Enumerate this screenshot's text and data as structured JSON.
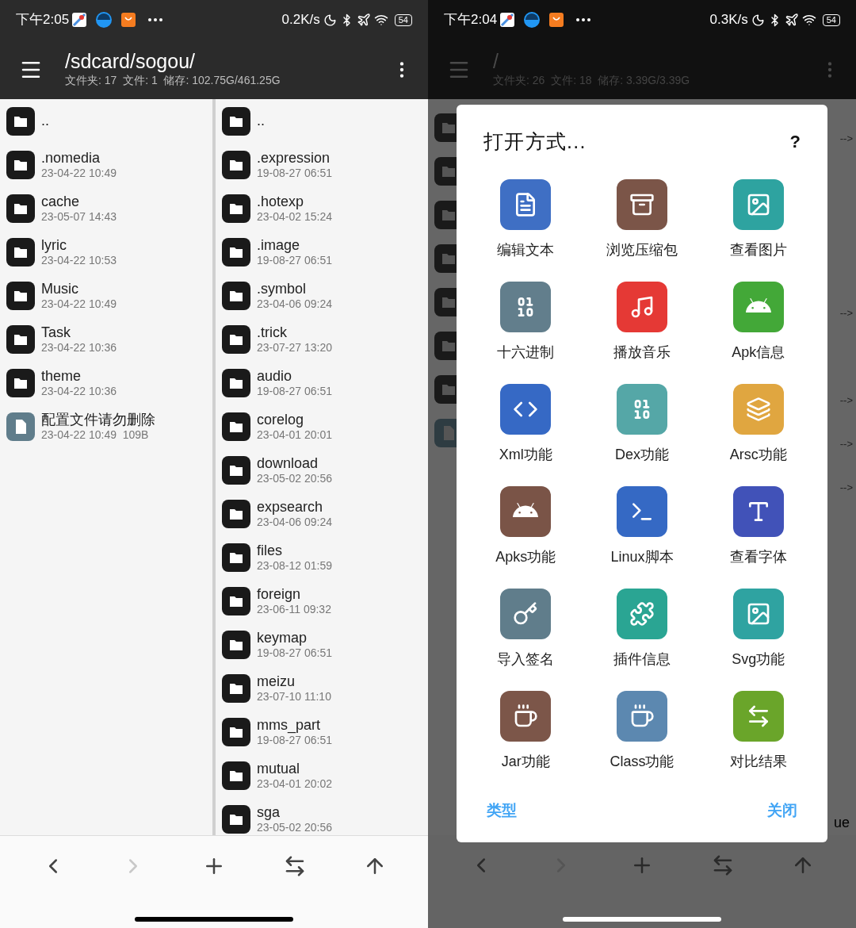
{
  "left_phone": {
    "status_bar": {
      "time": "下午2:05",
      "speed": "0.2K/s",
      "battery": "54"
    },
    "toolbar": {
      "path": "/sdcard/sogou/",
      "info": "文件夹: 17  文件: 1  储存: 102.75G/461.25G"
    },
    "panes": [
      {
        "rows": [
          {
            "kind": "folder",
            "name": ".."
          },
          {
            "kind": "folder",
            "name": ".nomedia",
            "meta": "23-04-22 10:49"
          },
          {
            "kind": "folder",
            "name": "cache",
            "meta": "23-05-07 14:43"
          },
          {
            "kind": "folder",
            "name": "lyric",
            "meta": "23-04-22 10:53"
          },
          {
            "kind": "folder",
            "name": "Music",
            "meta": "23-04-22 10:49"
          },
          {
            "kind": "folder",
            "name": "Task",
            "meta": "23-04-22 10:36"
          },
          {
            "kind": "folder",
            "name": "theme",
            "meta": "23-04-22 10:36"
          },
          {
            "kind": "file",
            "name": "配置文件请勿删除",
            "meta": "23-04-22 10:49  109B"
          }
        ]
      },
      {
        "rows": [
          {
            "kind": "folder",
            "name": ".."
          },
          {
            "kind": "folder",
            "name": ".expression",
            "meta": "19-08-27 06:51"
          },
          {
            "kind": "folder",
            "name": ".hotexp",
            "meta": "23-04-02 15:24"
          },
          {
            "kind": "folder",
            "name": ".image",
            "meta": "19-08-27 06:51"
          },
          {
            "kind": "folder",
            "name": ".symbol",
            "meta": "23-04-06 09:24"
          },
          {
            "kind": "folder",
            "name": ".trick",
            "meta": "23-07-27 13:20"
          },
          {
            "kind": "folder",
            "name": "audio",
            "meta": "19-08-27 06:51"
          },
          {
            "kind": "folder",
            "name": "corelog",
            "meta": "23-04-01 20:01"
          },
          {
            "kind": "folder",
            "name": "download",
            "meta": "23-05-02 20:56"
          },
          {
            "kind": "folder",
            "name": "expsearch",
            "meta": "23-04-06 09:24"
          },
          {
            "kind": "folder",
            "name": "files",
            "meta": "23-08-12 01:59"
          },
          {
            "kind": "folder",
            "name": "foreign",
            "meta": "23-06-11 09:32"
          },
          {
            "kind": "folder",
            "name": "keymap",
            "meta": "19-08-27 06:51"
          },
          {
            "kind": "folder",
            "name": "meizu",
            "meta": "23-07-10 11:10"
          },
          {
            "kind": "folder",
            "name": "mms_part",
            "meta": "19-08-27 06:51"
          },
          {
            "kind": "folder",
            "name": "mutual",
            "meta": "23-04-01 20:02"
          },
          {
            "kind": "folder",
            "name": "sga",
            "meta": "23-05-02 20:56"
          }
        ]
      }
    ],
    "nav_buttons": [
      {
        "kind": "back",
        "disabled": false
      },
      {
        "kind": "forward",
        "disabled": true
      },
      {
        "kind": "add",
        "disabled": false
      },
      {
        "kind": "swap",
        "disabled": false
      },
      {
        "kind": "up",
        "disabled": false
      }
    ]
  },
  "right_phone": {
    "status_bar": {
      "time": "下午2:04",
      "speed": "0.3K/s",
      "battery": "54"
    },
    "toolbar": {
      "path": "/",
      "info": "文件夹: 26  文件: 18  储存: 3.39G/3.39G"
    },
    "background_rows": [
      {
        "kind": "folder",
        "link": "-->"
      },
      {
        "kind": "folder"
      },
      {
        "kind": "folder"
      },
      {
        "kind": "folder"
      },
      {
        "kind": "folder",
        "link": "-->"
      },
      {
        "kind": "folder"
      },
      {
        "kind": "folder",
        "link": "-->"
      },
      {
        "kind": "file",
        "link": "-->"
      },
      {
        "kind": "none",
        "link": "-->"
      }
    ],
    "trailing_text": "ue",
    "nav_buttons": [
      {
        "kind": "back",
        "disabled": false
      },
      {
        "kind": "forward",
        "disabled": true
      },
      {
        "kind": "add",
        "disabled": false
      },
      {
        "kind": "swap",
        "disabled": false
      },
      {
        "kind": "up",
        "disabled": false
      }
    ],
    "dialog": {
      "title": "打开方式...",
      "help": "?",
      "options": [
        {
          "kind": "text",
          "label": "编辑文本",
          "color": "#3f6fc4"
        },
        {
          "kind": "archive",
          "label": "浏览压缩包",
          "color": "#7b5548"
        },
        {
          "kind": "image",
          "label": "查看图片",
          "color": "#2ea3a0"
        },
        {
          "kind": "hex",
          "label": "十六进制",
          "color": "#627e8c"
        },
        {
          "kind": "music",
          "label": "播放音乐",
          "color": "#e53935"
        },
        {
          "kind": "android",
          "label": "Apk信息",
          "color": "#43a838"
        },
        {
          "kind": "code",
          "label": "Xml功能",
          "color": "#3669c5"
        },
        {
          "kind": "hex",
          "label": "Dex功能",
          "color": "#55a7a7"
        },
        {
          "kind": "layers",
          "label": "Arsc功能",
          "color": "#e0a640"
        },
        {
          "kind": "android",
          "label": "Apks功能",
          "color": "#7a5447"
        },
        {
          "kind": "terminal",
          "label": "Linux脚本",
          "color": "#3569c4"
        },
        {
          "kind": "font",
          "label": "查看字体",
          "color": "#4152b8"
        },
        {
          "kind": "key",
          "label": "导入签名",
          "color": "#607d8b"
        },
        {
          "kind": "puzzle",
          "label": "插件信息",
          "color": "#2aa593"
        },
        {
          "kind": "image",
          "label": "Svg功能",
          "color": "#2fa3a1"
        },
        {
          "kind": "coffee",
          "label": "Jar功能",
          "color": "#7c5649"
        },
        {
          "kind": "coffee",
          "label": "Class功能",
          "color": "#5c88b0"
        },
        {
          "kind": "compare",
          "label": "对比结果",
          "color": "#6aa52a"
        }
      ],
      "buttons": [
        "类型",
        "关闭"
      ]
    }
  }
}
